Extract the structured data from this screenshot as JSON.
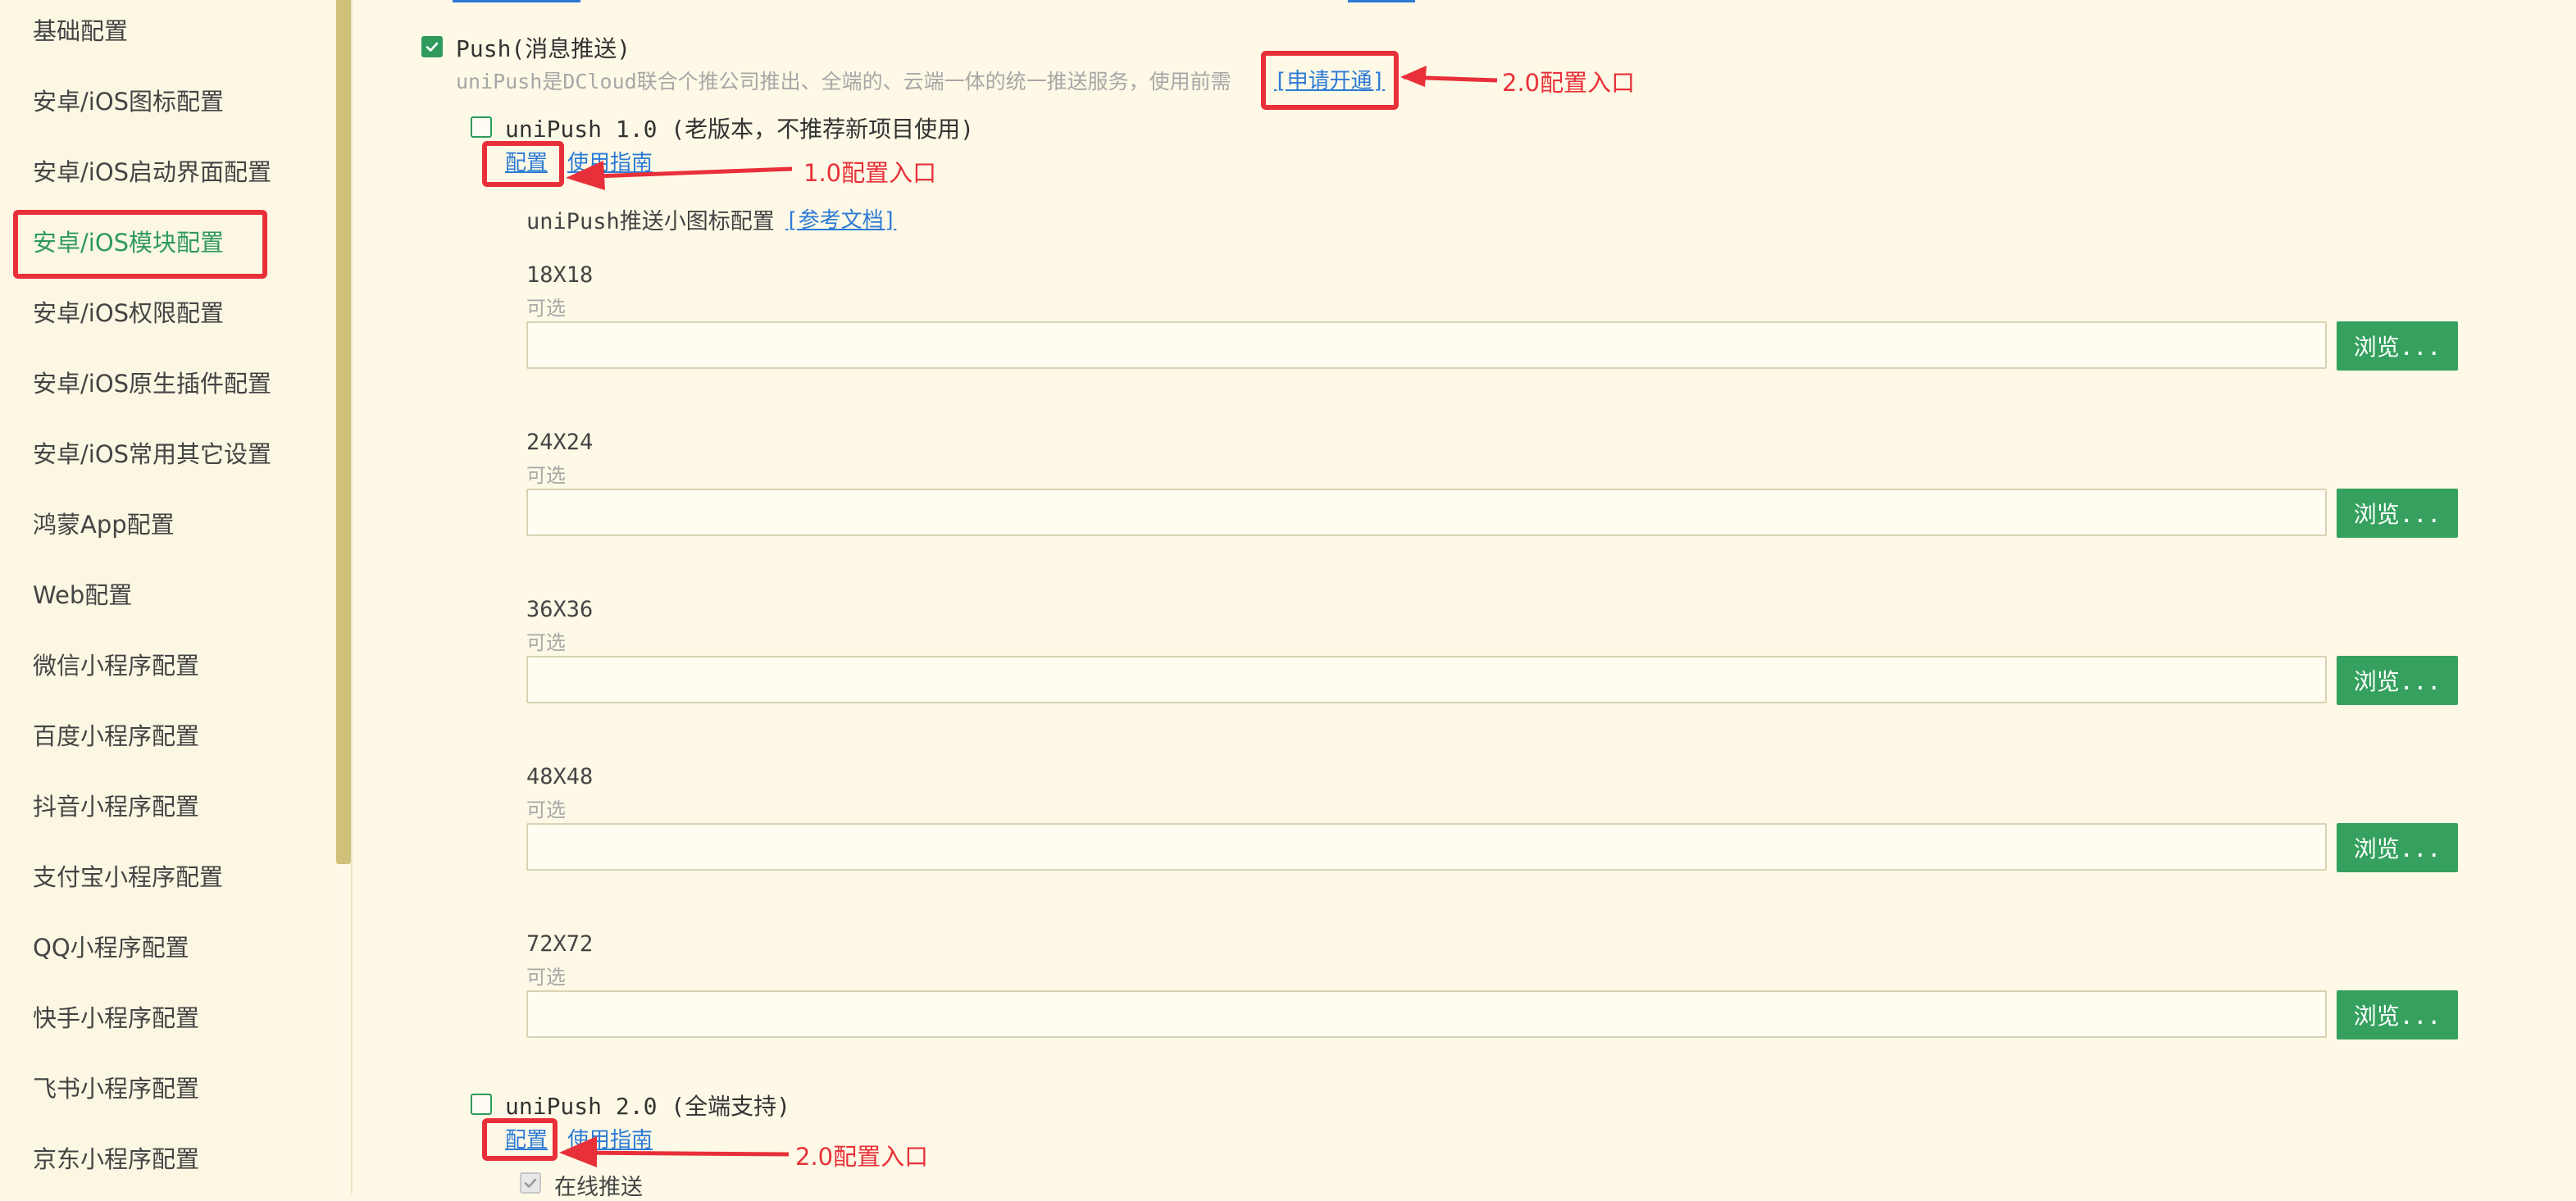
{
  "sidebar": {
    "items": [
      {
        "label": "基础配置",
        "active": false
      },
      {
        "label": "安卓/iOS图标配置",
        "active": false
      },
      {
        "label": "安卓/iOS启动界面配置",
        "active": false
      },
      {
        "label": "安卓/iOS模块配置",
        "active": true
      },
      {
        "label": "安卓/iOS权限配置",
        "active": false
      },
      {
        "label": "安卓/iOS原生插件配置",
        "active": false
      },
      {
        "label": "安卓/iOS常用其它设置",
        "active": false
      },
      {
        "label": "鸿蒙App配置",
        "active": false
      },
      {
        "label": "Web配置",
        "active": false
      },
      {
        "label": "微信小程序配置",
        "active": false
      },
      {
        "label": "百度小程序配置",
        "active": false
      },
      {
        "label": "抖音小程序配置",
        "active": false
      },
      {
        "label": "支付宝小程序配置",
        "active": false
      },
      {
        "label": "QQ小程序配置",
        "active": false
      },
      {
        "label": "快手小程序配置",
        "active": false
      },
      {
        "label": "飞书小程序配置",
        "active": false
      },
      {
        "label": "京东小程序配置",
        "active": false
      }
    ]
  },
  "push": {
    "label": "Push(消息推送)",
    "checked": true,
    "description": "uniPush是DCloud联合个推公司推出、全端的、云端一体的统一推送服务，使用前需",
    "apply_link": "[申请开通]"
  },
  "unipush1": {
    "label": "uniPush 1.0 (老版本，不推荐新项目使用)",
    "checked": false,
    "config_link": "配置",
    "guide_link": "使用指南",
    "icon_config_label": "uniPush推送小图标配置",
    "doc_link": "[参考文档]",
    "optional_text": "可选",
    "browse_label": "浏览...",
    "sizes": [
      "18X18",
      "24X24",
      "36X36",
      "48X48",
      "72X72"
    ]
  },
  "unipush2": {
    "label": "uniPush 2.0 (全端支持)",
    "checked": false,
    "config_link": "配置",
    "guide_link": "使用指南",
    "online_push_label": "在线推送"
  },
  "annotations": {
    "entry_2_0_top": "2.0配置入口",
    "entry_1_0": "1.0配置入口",
    "entry_2_0_bottom": "2.0配置入口"
  },
  "colors": {
    "accent_green": "#2f9a5c",
    "link_blue": "#2c7ad6",
    "annotation_red": "#e8303a",
    "background": "#fdf9e6"
  }
}
